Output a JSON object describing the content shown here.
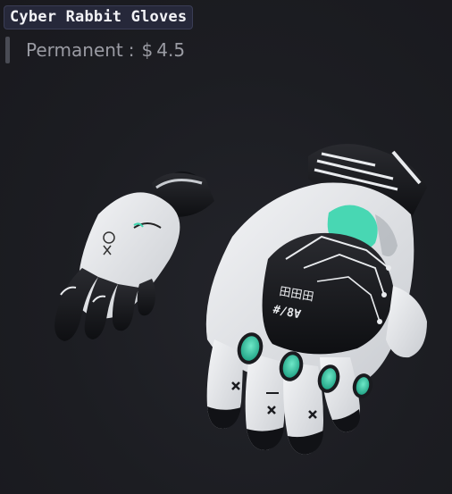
{
  "item": {
    "name": "Cyber Rabbit Gloves",
    "price_label": "Permanent",
    "price_separator": ":",
    "currency": "$",
    "price": "4.5",
    "image_alt": "gloves-image"
  },
  "glove_print": {
    "code_top": "田田田",
    "code_bottom": "#/8Ɐ"
  },
  "colors": {
    "background": "#1c1d22",
    "accent_teal": "#3fd6b0",
    "glove_white": "#e9ebee",
    "glove_black": "#1a1b1f",
    "badge_bg": "#26283a",
    "price_text": "#9a9ba3"
  }
}
